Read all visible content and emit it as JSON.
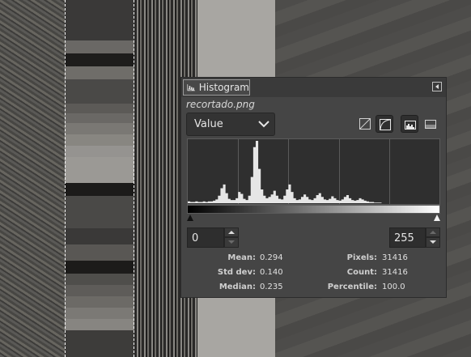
{
  "dialog": {
    "tab_label": "Histogram",
    "image_name": "recortado.png",
    "channel": "Value"
  },
  "histogram": {
    "heights": [
      0.03,
      0.02,
      0.02,
      0.03,
      0.02,
      0.02,
      0.03,
      0.02,
      0.03,
      0.03,
      0.04,
      0.06,
      0.12,
      0.24,
      0.3,
      0.16,
      0.07,
      0.05,
      0.05,
      0.08,
      0.18,
      0.15,
      0.07,
      0.05,
      0.12,
      0.42,
      0.9,
      1.0,
      0.55,
      0.22,
      0.12,
      0.08,
      0.1,
      0.14,
      0.2,
      0.12,
      0.07,
      0.06,
      0.12,
      0.22,
      0.3,
      0.18,
      0.08,
      0.05,
      0.06,
      0.1,
      0.14,
      0.1,
      0.06,
      0.05,
      0.08,
      0.13,
      0.16,
      0.1,
      0.06,
      0.05,
      0.07,
      0.11,
      0.08,
      0.05,
      0.04,
      0.06,
      0.1,
      0.13,
      0.08,
      0.05,
      0.04,
      0.05,
      0.08,
      0.06,
      0.04,
      0.03,
      0.02,
      0.02,
      0.01,
      0.01,
      0.01,
      0.0,
      0.0,
      0.0,
      0.0,
      0.0,
      0.0,
      0.0,
      0.0,
      0.0,
      0.0,
      0.0,
      0.0,
      0.0,
      0.0,
      0.0,
      0.0,
      0.0,
      0.0,
      0.0,
      0.0,
      0.0,
      0.0,
      0.0
    ]
  },
  "range": {
    "low": "0",
    "high": "255"
  },
  "stats": {
    "mean_label": "Mean:",
    "mean": "0.294",
    "stddev_label": "Std dev:",
    "stddev": "0.140",
    "median_label": "Median:",
    "median": "0.235",
    "pixels_label": "Pixels:",
    "pixels": "31416",
    "count_label": "Count:",
    "count": "31416",
    "percentile_label": "Percentile:",
    "percentile": "100.0"
  },
  "colors": {
    "histogram_fill": "#e6e6e6",
    "panel_bg": "#454545"
  }
}
